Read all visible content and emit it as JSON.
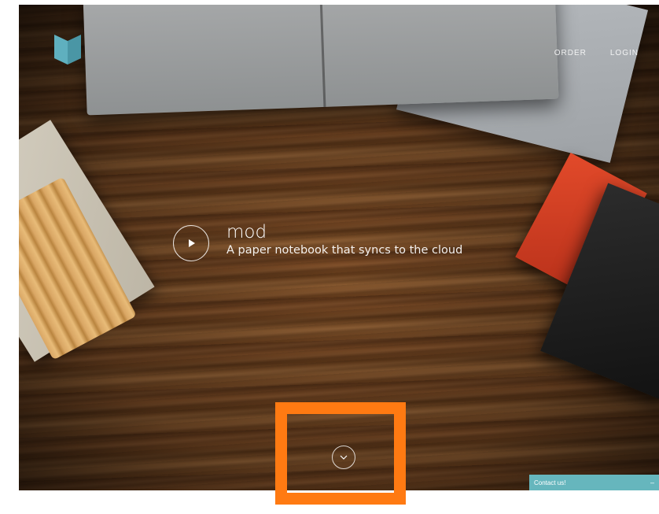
{
  "header": {
    "logo_icon": "bookmark-logo-icon",
    "nav": [
      {
        "label": "ORDER"
      },
      {
        "label": "LOGIN"
      }
    ]
  },
  "hero": {
    "play_icon": "play-icon",
    "title": "mod",
    "subtitle": "A paper notebook that syncs to the cloud"
  },
  "scroll": {
    "icon": "chevron-down-icon"
  },
  "contact": {
    "label": "Contact us!",
    "toggle": "–"
  },
  "colors": {
    "accent": "#66b6bd",
    "highlight": "#ff7a12",
    "logo": "#5fb0bf"
  }
}
